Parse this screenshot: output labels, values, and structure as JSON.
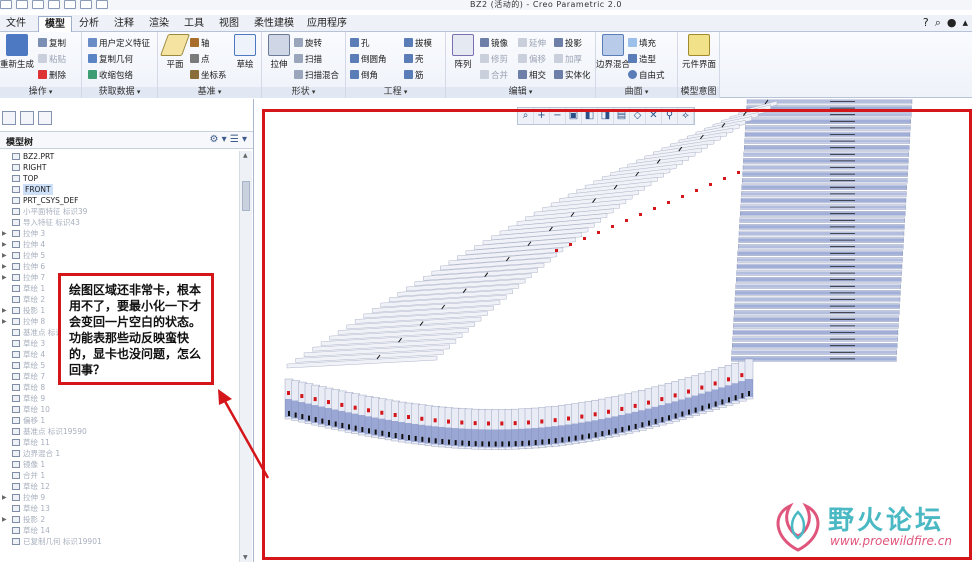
{
  "window": {
    "title": "BZ2 (活动的) - Creo Parametric 2.0"
  },
  "menu": {
    "tabs": [
      "文件",
      "模型",
      "分析",
      "注释",
      "渲染",
      "工具",
      "视图",
      "柔性建模",
      "应用程序"
    ],
    "active": "模型"
  },
  "ribbon": {
    "groups": {
      "operations": {
        "label": "操作",
        "regen": "重新生成",
        "copy": "复制",
        "paste": "粘贴",
        "delete": "删除"
      },
      "get_data": {
        "label": "获取数据",
        "udf": "用户定义特征",
        "copy_geom": "复制几何",
        "shrinkwrap": "收缩包络"
      },
      "datum": {
        "label": "基准",
        "plane": "平面",
        "axis": "轴",
        "point": "点",
        "csys": "坐标系",
        "sketch": "草绘"
      },
      "shapes": {
        "label": "形状",
        "extrude": "拉伸",
        "revolve": "旋转",
        "sweep": "扫描",
        "swept_blend": "扫描混合"
      },
      "engineering": {
        "label": "工程",
        "hole": "孔",
        "round": "倒圆角",
        "chamfer": "倒角",
        "draft": "拔模",
        "shell": "壳",
        "rib": "筋"
      },
      "editing": {
        "label": "编辑",
        "pattern": "阵列",
        "mirror": "镜像",
        "trim": "修剪",
        "merge": "合并",
        "extend": "延伸",
        "offset": "偏移",
        "intersect": "相交",
        "project": "投影",
        "thicken": "加厚",
        "solidify": "实体化"
      },
      "surfaces": {
        "label": "曲面",
        "boundary_blend": "边界混合",
        "fill": "填充",
        "style": "造型",
        "freestyle": "自由式"
      },
      "model_intent": {
        "label": "模型意图",
        "component_interface": "元件界面"
      }
    }
  },
  "model_tree": {
    "title": "模型树",
    "items": [
      {
        "label": "BZ2.PRT",
        "state": "on"
      },
      {
        "label": "RIGHT",
        "state": "on"
      },
      {
        "label": "TOP",
        "state": "on"
      },
      {
        "label": "FRONT",
        "state": "sel"
      },
      {
        "label": "PRT_CSYS_DEF",
        "state": "on"
      },
      {
        "label": "小平面特征 标识39",
        "state": "off"
      },
      {
        "label": "导入特征 标识43",
        "state": "off"
      },
      {
        "label": "拉伸 3",
        "state": "off"
      },
      {
        "label": "拉伸 4",
        "state": "off"
      },
      {
        "label": "拉伸 5",
        "state": "off"
      },
      {
        "label": "拉伸 6",
        "state": "off"
      },
      {
        "label": "拉伸 7",
        "state": "off"
      },
      {
        "label": "草绘 1",
        "state": "off"
      },
      {
        "label": "草绘 2",
        "state": "off"
      },
      {
        "label": "投影 1",
        "state": "off"
      },
      {
        "label": "拉伸 8",
        "state": "off"
      },
      {
        "label": "基准点 标识",
        "state": "off"
      },
      {
        "label": "草绘 3",
        "state": "off"
      },
      {
        "label": "草绘 4",
        "state": "off"
      },
      {
        "label": "草绘 5",
        "state": "off"
      },
      {
        "label": "草绘 7",
        "state": "off"
      },
      {
        "label": "草绘 8",
        "state": "off"
      },
      {
        "label": "草绘 9",
        "state": "off"
      },
      {
        "label": "草绘 10",
        "state": "off"
      },
      {
        "label": "偏移 1",
        "state": "off"
      },
      {
        "label": "基准点 标识19590",
        "state": "off"
      },
      {
        "label": "草绘 11",
        "state": "off"
      },
      {
        "label": "边界混合 1",
        "state": "off"
      },
      {
        "label": "镜像 1",
        "state": "off"
      },
      {
        "label": "合并 1",
        "state": "off"
      },
      {
        "label": "草绘 12",
        "state": "off"
      },
      {
        "label": "拉伸 9",
        "state": "off"
      },
      {
        "label": "草绘 13",
        "state": "off"
      },
      {
        "label": "投影 2",
        "state": "off"
      },
      {
        "label": "草绘 14",
        "state": "off"
      },
      {
        "label": "已复制几何 标识19901",
        "state": "off"
      }
    ]
  },
  "callout": {
    "text": "绘图区域还非常卡，根本用不了，要最小化一下才会变回一片空白的状态。功能表那些动反映蛮快的，显卡也没问题，怎么回事？"
  },
  "watermark": {
    "cn": "野火论坛",
    "en": "www.proewildfire.cn"
  },
  "colors": {
    "red_annotation": "#d4161b",
    "model_blue": "#5a6fb8"
  }
}
